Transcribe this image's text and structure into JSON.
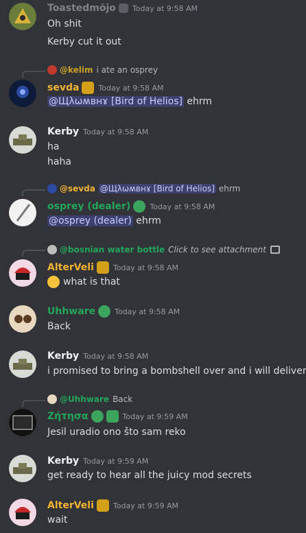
{
  "messages": [
    {
      "author": "Toastedmöjo",
      "author_color": "#7e8289",
      "timestamp": "Today at 9:58 AM",
      "lines": [
        "Oh shit",
        "Kerby cut it out"
      ]
    },
    {
      "reply": {
        "author": "@kelim",
        "author_color": "#c9a227",
        "text": "i ate an osprey"
      },
      "author": "sevda",
      "author_color": "#f0b232",
      "timestamp": "Today at 9:58 AM",
      "mention": "@Щλωʍвнɤ [Bird of Helios]",
      "text_after": "ehrm"
    },
    {
      "author": "Kerby",
      "author_color": "#f2f3f5",
      "timestamp": "Today at 9:58 AM",
      "lines": [
        "ha",
        "haha"
      ]
    },
    {
      "reply": {
        "author": "@sevda",
        "author_color": "#f0b232",
        "mention": "@Щλωʍвнɤ [Bird of Helios]",
        "text": "ehrm"
      },
      "author": "osprey (dealer)",
      "author_color": "#23a55a",
      "timestamp": "Today at 9:58 AM",
      "mention": "@osprey (dealer)",
      "text_after": "ehrm"
    },
    {
      "reply": {
        "author": "@bosnian water bottle",
        "author_color": "#23a55a",
        "text": "Click to see attachment"
      },
      "author": "AlterVeli",
      "author_color": "#f0b232",
      "timestamp": "Today at 9:58 AM",
      "text": "what is that",
      "emoji_icon": "crying-face-icon"
    },
    {
      "author": "Uhhware",
      "author_color": "#23a55a",
      "timestamp": "Today at 9:58 AM",
      "text": "Back"
    },
    {
      "author": "Kerby",
      "author_color": "#f2f3f5",
      "timestamp": "Today at 9:58 AM",
      "text": "i promised to bring a bombshell over and i will deliver"
    },
    {
      "reply": {
        "author": "@Uhhware",
        "author_color": "#23a55a",
        "text": "Back"
      },
      "author": "Ζήτησα",
      "author_color": "#23a55a",
      "timestamp": "Today at 9:59 AM",
      "text": "Jesil uradio ono što sam reko"
    },
    {
      "author": "Kerby",
      "author_color": "#f2f3f5",
      "timestamp": "Today at 9:59 AM",
      "text": "get ready to hear all the juicy mod secrets"
    },
    {
      "author": "AlterVeli",
      "author_color": "#f0b232",
      "timestamp": "Today at 9:59 AM",
      "text": "wait"
    }
  ]
}
